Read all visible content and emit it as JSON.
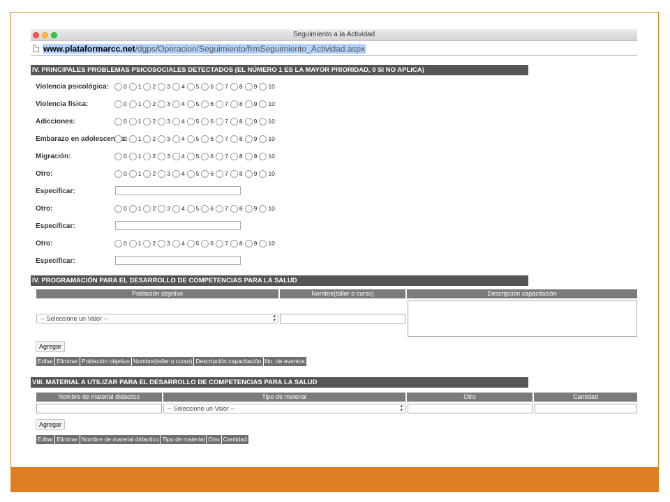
{
  "window": {
    "title": "Seguimiento a la Actividad"
  },
  "url": {
    "host": "www.plataformarcc.net",
    "path": "/dgps/Operacion/Seguimiento/frmSeguimiento_Actividad.aspx"
  },
  "section_iv_problems": {
    "title": "IV. PRINCIPALES PROBLEMAS PSICOSOCIALES DETECTADOS (EL NÚMERO 1 ES LA MAYOR PRIORIDAD, 0 SI NO APLICA)",
    "scale": [
      "0",
      "1",
      "2",
      "3",
      "4",
      "5",
      "6",
      "7",
      "8",
      "9",
      "10"
    ],
    "rows": [
      {
        "label": "Violencia psicológica:",
        "type": "radio"
      },
      {
        "label": "Violencia física:",
        "type": "radio"
      },
      {
        "label": "Adicciones:",
        "type": "radio"
      },
      {
        "label": "Embarazo en adolescencia:",
        "type": "radio"
      },
      {
        "label": "Migración:",
        "type": "radio"
      },
      {
        "label": "Otro:",
        "type": "radio"
      },
      {
        "label": "Especificar:",
        "type": "text"
      },
      {
        "label": "Otro:",
        "type": "radio"
      },
      {
        "label": "Especificar:",
        "type": "text"
      },
      {
        "label": "Otro:",
        "type": "radio"
      },
      {
        "label": "Especificar:",
        "type": "text"
      }
    ]
  },
  "section_iv_program": {
    "title": "IV. PROGRAMACIÓN PARA EL DESARROLLO DE COMPETENCIAS PARA LA SALUD",
    "headers": [
      "Población objetivo",
      "Nombre(taller o curso)",
      "Descripción capacitación"
    ],
    "select_value": "-- Seleccione un Valor --",
    "add_label": "Agregar",
    "grid_headers": [
      "Editar",
      "Eliminar",
      "Población objetivo",
      "Nombre(taller o curso)",
      "Descripción capacitación",
      "No. de eventos"
    ]
  },
  "section_viii_material": {
    "title": "VIII. MATERIAL A UTILIZAR PARA EL DESARROLLO DE COMPETENCIAS PARA LA SALUD",
    "headers": [
      "Nombre de material didactico",
      "Tipo de material",
      "Otro",
      "Cantidad"
    ],
    "select_value": "-- Seleccione un Valor --",
    "add_label": "Agregar",
    "grid_headers": [
      "Editar",
      "Eliminar",
      "Nombre de material didactico",
      "Tipo de material",
      "Otro",
      "Cantidad"
    ]
  },
  "colors": {
    "accent": "#e07f22",
    "section_bar": "#555555",
    "table_header": "#7b7b7b"
  }
}
